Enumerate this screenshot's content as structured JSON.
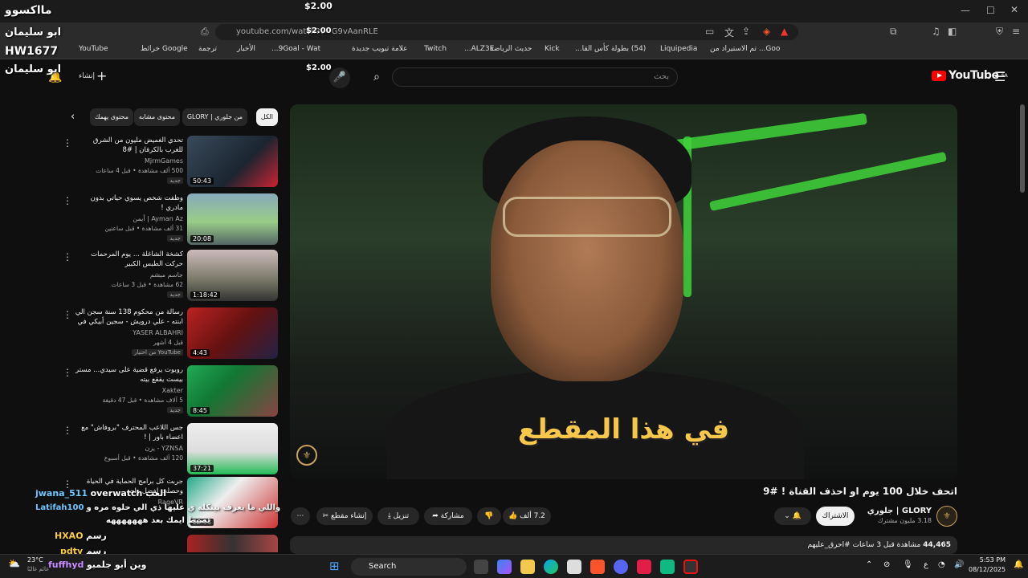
{
  "browser": {
    "url": "youtube.com/watch?v=G9vAanRLE",
    "bookmarks": [
      "YouTube",
      "Google خرائط",
      "ترجمة",
      "الأخبار",
      "9Goal - Wat...",
      "علامة تبويب جديدة",
      "Twitch",
      "ALZ3E...",
      "حديث الرياضة",
      "Kick",
      "(54) بطولة كأس القا...",
      "Liquipedia",
      "Goo... تم الاستيراد من"
    ],
    "tab_icons": [
      "back-icon",
      "reload-icon"
    ]
  },
  "youtube": {
    "logo": "YouTube",
    "logo_region": "SA",
    "search_placeholder": "بحث",
    "create_label": "إنشاء"
  },
  "video": {
    "caption": "في هذا المقطع",
    "title": "اتحف خلال 100 يوم او احذف القناة ! #9",
    "channel": "جلوري | GLORY",
    "subscribers": "3.18 مليون مشترك",
    "subscribe_label": "الاشتراك",
    "likes": "7.2 ألف",
    "share_label": "مشاركة",
    "download_label": "تنزيل",
    "clip_label": "إنشاء مقطع",
    "views": "44,465",
    "description_meta": "مشاهدة قبل 3 ساعات #احرق_عليهم"
  },
  "chips": {
    "all": "الكل",
    "from_channel": "من جلوري | GLORY",
    "related": "محتوى مشابه",
    "more": "محتوى يهمك"
  },
  "recommendations": [
    {
      "title": "تحدي الغميض مليون من الشرق للغرب بالكرفان | #8",
      "channel": "MjrmGames",
      "meta": "500 ألف مشاهدة • قبل 4 ساعات",
      "badge": "جديد",
      "duration": "50:43"
    },
    {
      "title": "وظفت شخص يسوي حياتي بدون مادري !",
      "channel": "Ayman Az | أيمن",
      "meta": "31 ألف مشاهدة • قبل ساعتين",
      "badge": "جديد",
      "duration": "20:08"
    },
    {
      "title": "كشخة الشاغلة ... يوم المرحمات حركت الطبس الكبير",
      "channel": "جاسم ميشم",
      "meta": "62 مشاهدة • قبل 3 ساعات",
      "badge": "جديد",
      "duration": "1:18:42"
    },
    {
      "title": "رسالة من محكوم 138 سنة سجن الي ابنته - علي درويش - سجين أبيكي في امريكا",
      "channel": "YASER ALBAHRI",
      "meta": "قبل 4 أشهر",
      "badge": "من اختيار YouTube",
      "duration": "4:43"
    },
    {
      "title": "روبوت يرفع قضية على سيدي... مستر بيست يفقع بيته",
      "channel": "Xakter",
      "meta": "5 آلاف مشاهدة • قبل 47 دقيقة",
      "badge": "جديد",
      "duration": "8:45"
    },
    {
      "title": "جس اللاعب المحترف \"بروفاش\" مع اعضاء باور | !",
      "channel": "YZNSA - يزن",
      "meta": "120 ألف مشاهدة • قبل أسبوع",
      "badge": "",
      "duration": "37:21"
    },
    {
      "title": "جربت كل برامج الحماية في الحياة وحصلت لفضل واحد",
      "channel": "RageVR",
      "meta": "",
      "badge": "",
      "duration": "28:53"
    }
  ],
  "overlay": {
    "donations": [
      "$2.00",
      "$2.00",
      "$2.00"
    ],
    "names_top": [
      "مااكسوو",
      "ابو سليمان",
      "HW1677",
      "ابو سليمان"
    ],
    "chat": [
      {
        "user": "jwana_511",
        "text": "overwatch العب"
      },
      {
        "user": "Latifah100",
        "text": "تضيط ايمك بعد هههههههه"
      },
      {
        "user": "HXAO",
        "text": "رسم"
      },
      {
        "user": "pdty",
        "text": "رسم"
      },
      {
        "user": "fuffhyd",
        "text": "وين أبو جلمبو"
      }
    ],
    "chat_extra": "واللي ما يعرف بيتكله ي عليها ذي الي حلوه مره و"
  },
  "taskbar": {
    "weather_temp": "23°C",
    "weather_desc": "غائم غالبًا",
    "search": "Search",
    "lang": "ع",
    "time": "5:53 PM",
    "date": "08/12/2025"
  }
}
